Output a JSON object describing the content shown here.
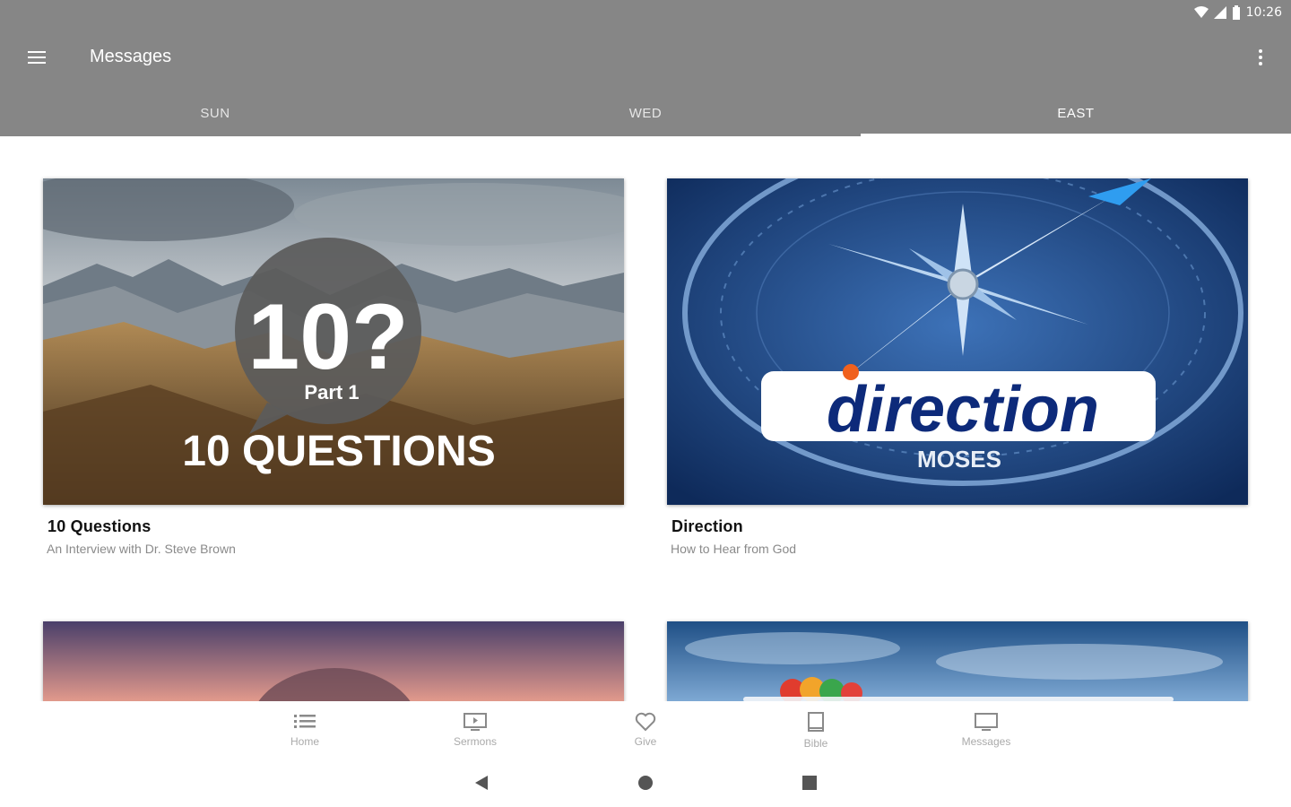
{
  "status_bar": {
    "time": "10:26"
  },
  "app_bar": {
    "title": "Messages",
    "menu_icon": "hamburger-menu-icon",
    "overflow_icon": "more-vert-icon"
  },
  "tabs": [
    {
      "label": "SUN",
      "active": false
    },
    {
      "label": "WED",
      "active": false
    },
    {
      "label": "EAST",
      "active": true
    }
  ],
  "cards": [
    {
      "title": "10 Questions",
      "subtitle": "An Interview with Dr. Steve Brown",
      "art": {
        "big": "10?",
        "part": "Part 1",
        "caption": "10 QUESTIONS"
      }
    },
    {
      "title": "Direction",
      "subtitle": "How to Hear from God",
      "art": {
        "logo": "direction",
        "caption": "MOSES"
      }
    }
  ],
  "bottom_nav": [
    {
      "label": "Home",
      "icon": "list-icon"
    },
    {
      "label": "Sermons",
      "icon": "sermons-tv-icon"
    },
    {
      "label": "Give",
      "icon": "heart-icon"
    },
    {
      "label": "Bible",
      "icon": "book-icon"
    },
    {
      "label": "Messages",
      "icon": "monitor-icon"
    }
  ],
  "colors": {
    "app_bar": "#868686",
    "direction_blue": "#0d2a7a",
    "accent_orange": "#f0611e"
  }
}
